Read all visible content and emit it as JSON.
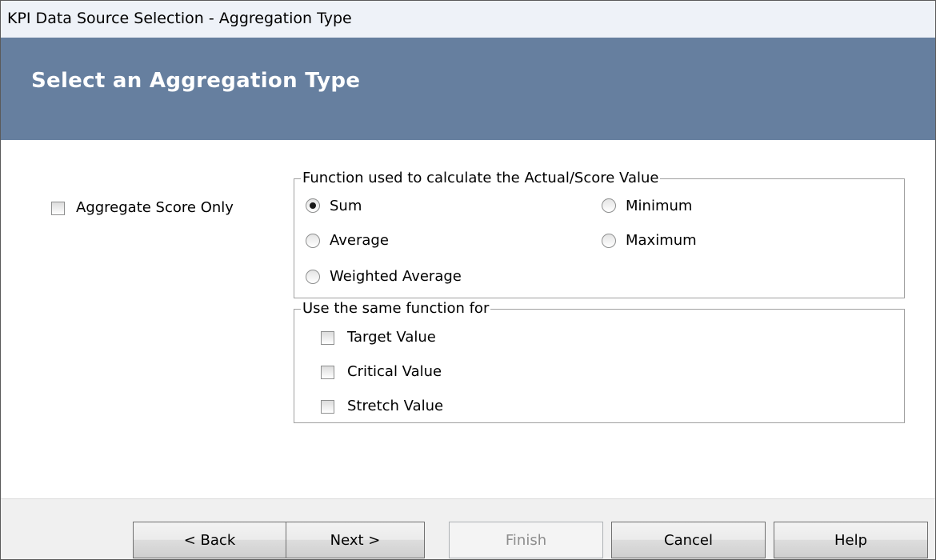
{
  "window": {
    "title": "KPI Data Source Selection - Aggregation Type"
  },
  "banner": {
    "heading": "Select an Aggregation Type"
  },
  "options": {
    "aggregate_score_only": {
      "label": "Aggregate Score Only",
      "checked": false
    }
  },
  "function_group": {
    "legend": "Function used to calculate the Actual/Score Value",
    "radios": [
      {
        "label": "Sum",
        "checked": true
      },
      {
        "label": "Minimum",
        "checked": false
      },
      {
        "label": "Average",
        "checked": false
      },
      {
        "label": "Maximum",
        "checked": false
      },
      {
        "label": "Weighted Average",
        "checked": false
      }
    ]
  },
  "same_function_group": {
    "legend": "Use the same function for",
    "checkboxes": [
      {
        "label": "Target Value",
        "checked": false
      },
      {
        "label": "Critical Value",
        "checked": false
      },
      {
        "label": "Stretch Value",
        "checked": false
      }
    ]
  },
  "buttons": {
    "back": "< Back",
    "next": "Next >",
    "finish": "Finish",
    "cancel": "Cancel",
    "help": "Help",
    "finish_disabled": true
  }
}
